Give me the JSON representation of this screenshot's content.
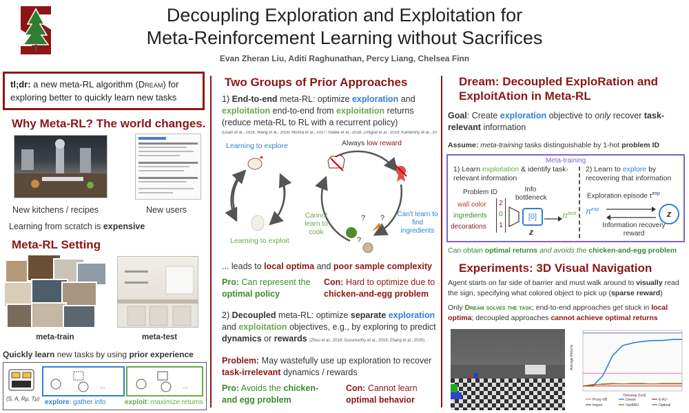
{
  "header": {
    "title_line1": "Decoupling Exploration and Exploitation for",
    "title_line2": "Meta-Reinforcement Learning without Sacrifices",
    "authors": "Evan Zheran Liu, Aditi Raghunathan, Percy Liang, Chelsea Finn"
  },
  "left": {
    "tldr_label": "tl;dr:",
    "tldr_text1": " a new meta-RL algorithm (",
    "tldr_dream": "Dream",
    "tldr_text2": ") for exploring better to quickly learn new tasks",
    "why_title": "Why Meta-RL? The world changes.",
    "caption_kitchens": "New kitchens / recipes",
    "caption_users": "New users",
    "scratch_text": "Learning from scratch is ",
    "scratch_bold": "expensive",
    "setting_title": "Meta-RL Setting",
    "caption_train": "meta-train",
    "caption_test": "meta-test",
    "quick_bold1": "Quickly learn",
    "quick_text": " new tasks by using ",
    "quick_bold2": "prior experience",
    "explore_label": "explore",
    "explore_text": ": gather info",
    "exploit_label": "exploit",
    "exploit_text": ": maximize returns",
    "mdp_tuple": "(S, A, Rμ, Tμ)",
    "ellipsis": "..."
  },
  "middle": {
    "title": "Two Groups of Prior Approaches",
    "e2e_num": "1) ",
    "e2e_bold": "End-to-end",
    "e2e_t1": " meta-RL: optimize ",
    "e2e_explore": "exploration",
    "e2e_t2": " and ",
    "e2e_exploit": "exploitation",
    "e2e_t3": " end-to-end from ",
    "e2e_exploit2": "exploitation",
    "e2e_t4": " returns (reduce meta-RL to RL with a recurrent policy)",
    "e2e_cite": "(Duan et al., 2016; Wang et al., 2016; Mishra et al., 2017; Stadie et al., 2018; Zintgraf et al., 2019; Kamienny et al., 2020)",
    "learn_explore": "Learning to explore",
    "learn_exploit": "Learning to exploit",
    "always": "Always ",
    "low_reward": "low reward",
    "cannot_cook": "Cannot learn to cook",
    "cant_find": "Can't learn to find ingredients",
    "leads_t1": "... leads to ",
    "leads_b1": "local optima",
    "leads_t2": " and ",
    "leads_b2": "poor sample complexity",
    "pro1_label": "Pro:",
    "pro1_text": " Can represent the ",
    "pro1_bold": "optimal policy",
    "con1_label": "Con:",
    "con1_text": " Hard to optimize due to ",
    "con1_bold": "chicken-and-egg problem",
    "dec_num": "2) ",
    "dec_bold": "Decoupled",
    "dec_t1": " meta-RL: optimize ",
    "dec_sep": "separate",
    "dec_explore": "exploration",
    "dec_t2": " and ",
    "dec_exploit": "exploitation",
    "dec_t3": " objectives, e.g., by exploring to predict ",
    "dec_dyn": "dynamics",
    "dec_t4": " or ",
    "dec_rew": "rewards",
    "dec_cite": "(Zhou et al., 2019; Gurumurthy et al., 2019; Zhang et al., 2020)",
    "problem_label": "Problem:",
    "problem_text": " May wastefully use up exploration to recover ",
    "problem_bold": "task-irrelevant",
    "problem_text2": " dynamics / rewards",
    "pro2_label": "Pro:",
    "pro2_text": " Avoids the ",
    "pro2_bold": "chicken-and egg problem",
    "con2_label": "Con:",
    "con2_text": " Cannot learn ",
    "con2_bold": "optimal behavior"
  },
  "right": {
    "title_line1": "Dream: Decoupled ExploRation and",
    "title_line2": "ExploitAtion in Meta-RL",
    "goal_label": "Goal",
    "goal_t1": ": Create ",
    "goal_explore": "exploration",
    "goal_t2": " objective to ",
    "goal_only": "only",
    "goal_t3": " recover ",
    "goal_bold": "task-relevant",
    "goal_t4": " information",
    "assume_label": "Assume:",
    "assume_t1": " meta-training",
    "assume_t2": " tasks distinguishable by 1-hot ",
    "assume_bold": "problem ID",
    "box_title": "Meta-training",
    "step1": "1) Learn exploitation & identify task-relevant information",
    "step1_exploit": "exploitation",
    "step2": "2) Learn to explore by recovering that information",
    "step2_explore": "explore",
    "problem_id": "Problem ID",
    "info_bottleneck": "Info bottleneck",
    "wall_color": "wall color",
    "ingredients": "ingredients",
    "decorations": "decorations",
    "v1": "2",
    "v2": "0",
    "v3": "1",
    "enc_out": "[0]",
    "z": "z",
    "pi_task": "π",
    "pi_task_sup": "task",
    "pi_exp": "π",
    "pi_exp_sup": "exp",
    "episode": "Exploration episode τ",
    "episode_sup": "exp",
    "info_recovery": "Information recovery reward",
    "obtain_t1": "Can obtain ",
    "obtain_b1": "optimal returns",
    "obtain_t2": " and avoids the ",
    "obtain_b2": "chicken-and-egg problem",
    "exp_title": "Experiments: 3D Visual Navigation",
    "exp_t1": "Agent starts on far side of barrier and must walk around to ",
    "exp_b1": "visually",
    "exp_t2": " read the sign, specifying what colored object to pick up (",
    "exp_b2": "sparse reward",
    "exp_t3": ")",
    "only_t1": "Only ",
    "only_b1": "Dream solves the task",
    "only_t2": "; end-to-end approaches get stuck in ",
    "only_b2": "local optima",
    "only_t3": "; decoupled approaches ",
    "only_b3": "cannot achieve optimal returns",
    "plot_ylabel": "Average Returns",
    "plot_xlabel": "Timestep (1e3)",
    "legend": [
      "Proxy-VB",
      "Dream",
      "E-RL²",
      "Import",
      "VariBAD",
      "Optimal"
    ]
  },
  "colors": {
    "cardinal": "#8c1515",
    "blue": "#2f7fd6",
    "green": "#3c8a2e",
    "purple": "#7e62c4"
  },
  "chart_data": {
    "type": "line",
    "xlabel": "Timestep (1e3)",
    "ylabel": "Average Returns",
    "x": [
      0,
      100,
      200,
      300,
      400,
      500,
      600,
      700,
      800,
      900,
      1000
    ],
    "series": [
      {
        "name": "Dream",
        "values": [
          -0.1,
          -0.1,
          0.1,
          0.5,
          0.7,
          0.75,
          0.78,
          0.8,
          0.8,
          0.82,
          0.82
        ]
      },
      {
        "name": "E-RL²",
        "values": [
          -0.1,
          -0.1,
          -0.1,
          -0.1,
          -0.1,
          -0.1,
          -0.1,
          -0.1,
          -0.1,
          -0.1,
          -0.1
        ]
      },
      {
        "name": "Import",
        "values": [
          -0.1,
          -0.08,
          -0.06,
          -0.05,
          -0.06,
          -0.05,
          -0.05,
          -0.06,
          -0.05,
          -0.05,
          -0.05
        ]
      },
      {
        "name": "VariBAD",
        "values": [
          -0.1,
          -0.07,
          -0.07,
          -0.06,
          -0.06,
          -0.06,
          -0.06,
          -0.06,
          -0.06,
          -0.06,
          -0.06
        ]
      },
      {
        "name": "Proxy-VB",
        "values": [
          0.15,
          0.15,
          0.15,
          0.15,
          0.15,
          0.15,
          0.15,
          0.15,
          0.15,
          0.15,
          0.15
        ]
      },
      {
        "name": "Optimal",
        "values": [
          0.95,
          0.95,
          0.95,
          0.95,
          0.95,
          0.95,
          0.95,
          0.95,
          0.95,
          0.95,
          0.95
        ]
      }
    ],
    "ylim": [
      -0.2,
      1.0
    ]
  }
}
